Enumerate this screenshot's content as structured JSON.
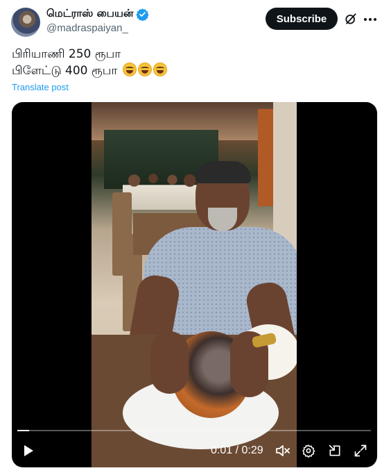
{
  "author": {
    "display_name": "மெட்ராஸ் பையன்",
    "handle": "@madraspaiyan_",
    "verified": true,
    "verified_color": "#1d9bf0"
  },
  "actions": {
    "subscribe_label": "Subscribe",
    "grok_icon": "grok-icon",
    "more_icon": "more-horizontal-icon"
  },
  "post": {
    "line1": "பிரியாணி 250 ரூபா",
    "line2": "பிளேட்டு 400 ரூபா",
    "emoji": "face-with-tears-of-joy",
    "emoji_count": 3,
    "translate_label": "Translate post"
  },
  "video": {
    "current_time": "0:01",
    "duration": "0:29",
    "time_display": "0:01 / 0:29",
    "progress": 0.034,
    "controls": [
      "play-icon",
      "mute-icon",
      "settings-icon",
      "pip-icon",
      "fullscreen-icon"
    ]
  },
  "colors": {
    "text_primary": "#0f1419",
    "text_secondary": "#536471",
    "link": "#1d9bf0",
    "button_dark": "#0f1419"
  }
}
